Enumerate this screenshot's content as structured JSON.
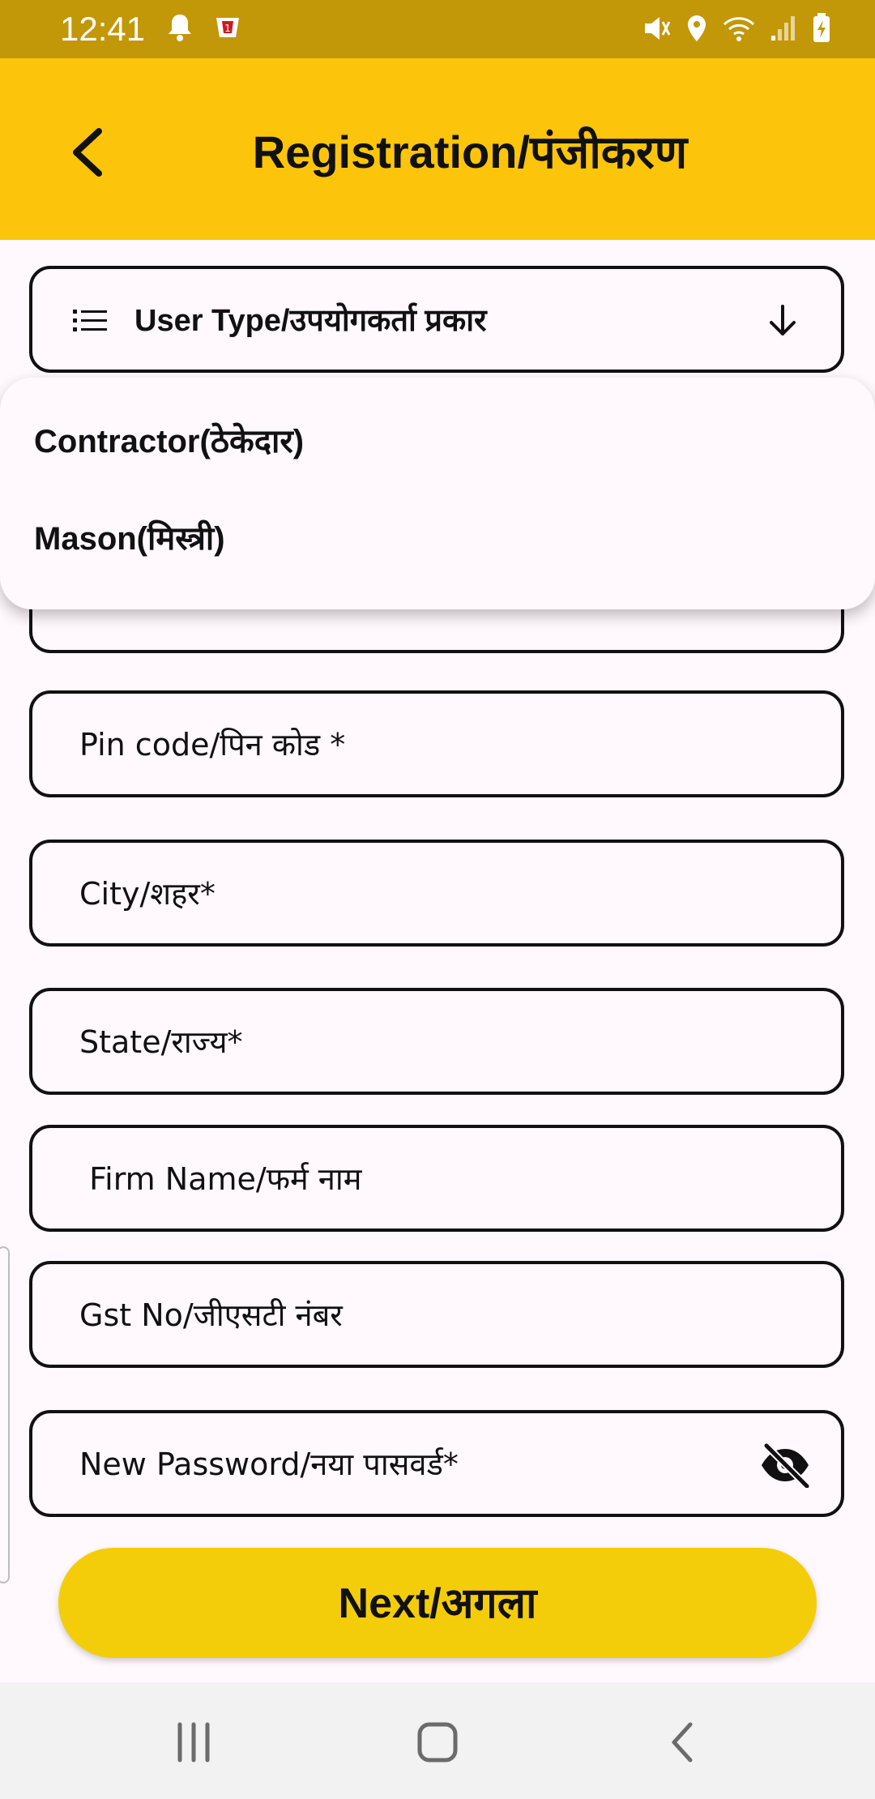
{
  "status_bar": {
    "time": "12:41",
    "icons": [
      "bell-icon",
      "app-notification-icon",
      "mute-icon",
      "location-icon",
      "wifi-icon",
      "signal-icon",
      "battery-charging-icon"
    ]
  },
  "app_bar": {
    "title": "Registration/पंजीकरण",
    "back_icon": "chevron-left-icon"
  },
  "form": {
    "user_type_label": "User Type/उपयोगकर्ता प्रकार",
    "pin_code_placeholder": "Pin code/पिन कोड *",
    "city_placeholder": "City/शहर*",
    "state_placeholder": "State/राज्य*",
    "firm_name_placeholder": " Firm Name/फर्म नाम",
    "gst_placeholder": "Gst No/जीएसटी नंबर",
    "password_placeholder": "New Password/नया पासवर्ड*",
    "next_label": "Next/अगला"
  },
  "dropdown": {
    "options": [
      "Contractor(ठेकेदार)",
      "Mason(मिस्त्री)"
    ]
  },
  "colors": {
    "status_bar": "#C29708",
    "app_bar": "#FCC50B",
    "button": "#F4CD0A",
    "background": "#FFF8FD"
  }
}
